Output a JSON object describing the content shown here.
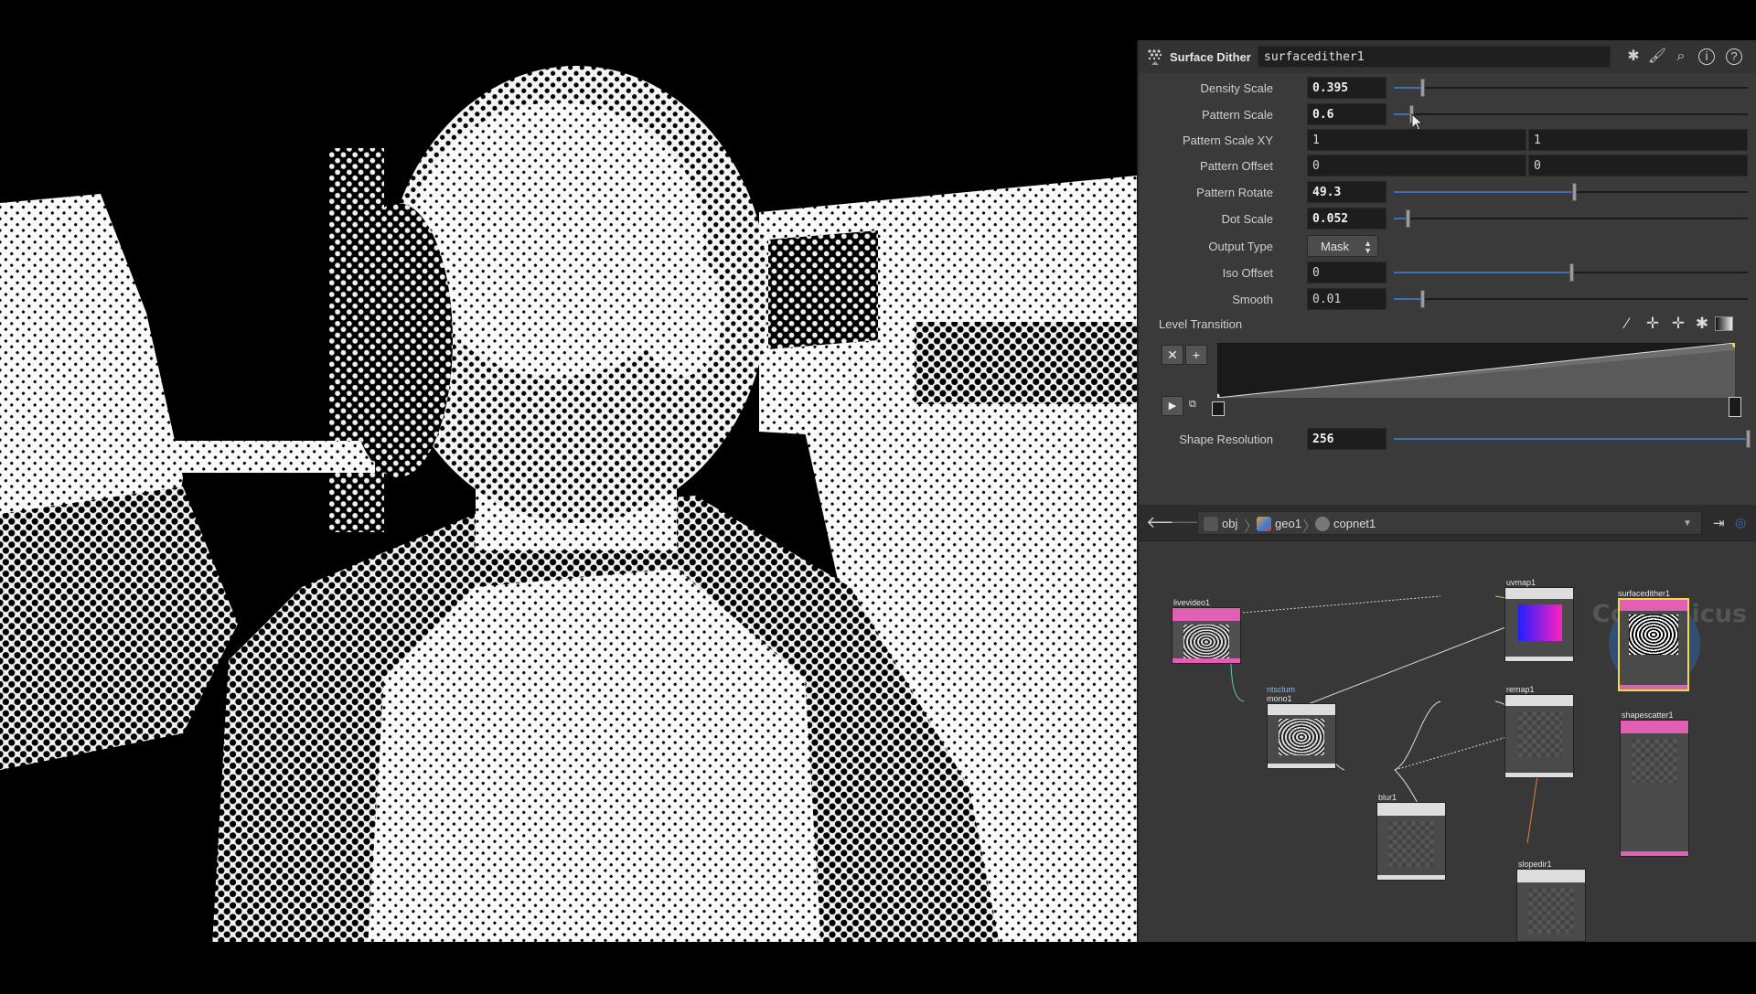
{
  "param_panel": {
    "node_type": "Surface Dither",
    "node_name": "surfacedither1",
    "header_icons": [
      "gear-icon",
      "brush-icon",
      "search-icon",
      "info-icon",
      "help-icon"
    ],
    "params": {
      "density_scale": {
        "label": "Density Scale",
        "value": "0.395",
        "level": 0.08
      },
      "pattern_scale": {
        "label": "Pattern Scale",
        "value": "0.6",
        "level": 0.05
      },
      "pattern_scale_xy": {
        "label": "Pattern Scale XY",
        "x": "1",
        "y": "1"
      },
      "pattern_offset": {
        "label": "Pattern Offset",
        "x": "0",
        "y": "0"
      },
      "pattern_rotate": {
        "label": "Pattern Rotate",
        "value": "49.3",
        "level": 0.51
      },
      "dot_scale": {
        "label": "Dot Scale",
        "value": "0.052",
        "level": 0.04
      },
      "output_type": {
        "label": "Output Type",
        "value": "Mask"
      },
      "iso_offset": {
        "label": "Iso Offset",
        "value": "0",
        "level": 0.5
      },
      "smooth": {
        "label": "Smooth",
        "value": "0.01",
        "level": 0.08
      },
      "level_transition": {
        "label": "Level Transition"
      },
      "shape_resolution": {
        "label": "Shape Resolution",
        "value": "256",
        "level": 1.0
      }
    }
  },
  "network": {
    "path": [
      "obj",
      "geo1",
      "copnet1"
    ],
    "context_label": "Copernicus",
    "nodes": {
      "livevideo1": "livevideo1",
      "ntsclum": "ntsclum",
      "mono1": "mono1",
      "blur1": "blur1",
      "uvmap1": "uvmap1",
      "remap1": "remap1",
      "surfacedither1": "surfacedither1",
      "shapescatter1": "shapescatter1",
      "slopedir1": "slopedir1"
    }
  },
  "colors": {
    "accent_blue": "#3d6fb5",
    "node_pink": "#e25fb6",
    "node_selected": "#f2d84a",
    "panel_bg": "#3a3a3a"
  }
}
